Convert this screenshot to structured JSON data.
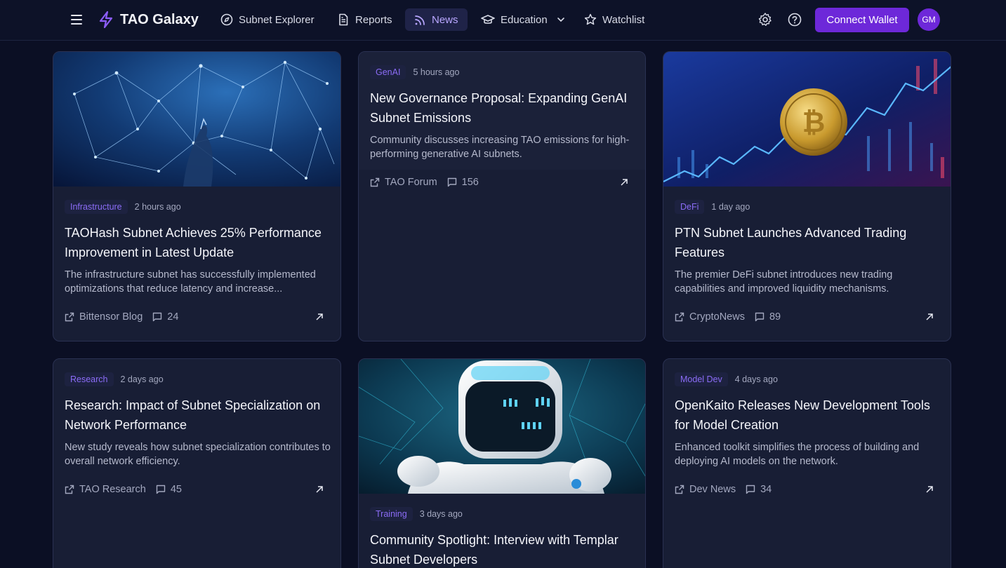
{
  "header": {
    "brand": "TAO Galaxy",
    "nav": [
      {
        "label": "Subnet Explorer",
        "icon": "compass-icon"
      },
      {
        "label": "Reports",
        "icon": "document-icon"
      },
      {
        "label": "News",
        "icon": "rss-icon",
        "active": true
      },
      {
        "label": "Education",
        "icon": "graduation-cap-icon",
        "dropdown": true
      },
      {
        "label": "Watchlist",
        "icon": "star-icon"
      }
    ],
    "connect_label": "Connect Wallet",
    "avatar_initials": "GM",
    "accent": "#6d28d9"
  },
  "articles": [
    {
      "category": "Infrastructure",
      "time": "2 hours ago",
      "title": "TAOHash Subnet Achieves 25% Performance Improvement in Latest Update",
      "description": "The infrastructure subnet has successfully implemented optimizations that reduce latency and increase...",
      "source": "Bittensor Blog",
      "comments": "24",
      "image": "network-hand-image"
    },
    {
      "category": "GenAI",
      "time": "5 hours ago",
      "title": "New Governance Proposal: Expanding GenAI Subnet Emissions",
      "description": "Community discusses increasing TAO emissions for high-performing generative AI subnets.",
      "source": "TAO Forum",
      "comments": "156",
      "image": null
    },
    {
      "category": "DeFi",
      "time": "1 day ago",
      "title": "PTN Subnet Launches Advanced Trading Features",
      "description": "The premier DeFi subnet introduces new trading capabilities and improved liquidity mechanisms.",
      "source": "CryptoNews",
      "comments": "89",
      "image": "bitcoin-chart-image"
    },
    {
      "category": "Research",
      "time": "2 days ago",
      "title": "Research: Impact of Subnet Specialization on Network Performance",
      "description": "New study reveals how subnet specialization contributes to overall network efficiency.",
      "source": "TAO Research",
      "comments": "45",
      "image": null
    },
    {
      "category": "Training",
      "time": "3 days ago",
      "title": "Community Spotlight: Interview with Templar Subnet Developers",
      "description": "",
      "source": "",
      "comments": "",
      "image": "robot-image"
    },
    {
      "category": "Model Dev",
      "time": "4 days ago",
      "title": "OpenKaito Releases New Development Tools for Model Creation",
      "description": "Enhanced toolkit simplifies the process of building and deploying AI models on the network.",
      "source": "Dev News",
      "comments": "34",
      "image": null
    }
  ]
}
